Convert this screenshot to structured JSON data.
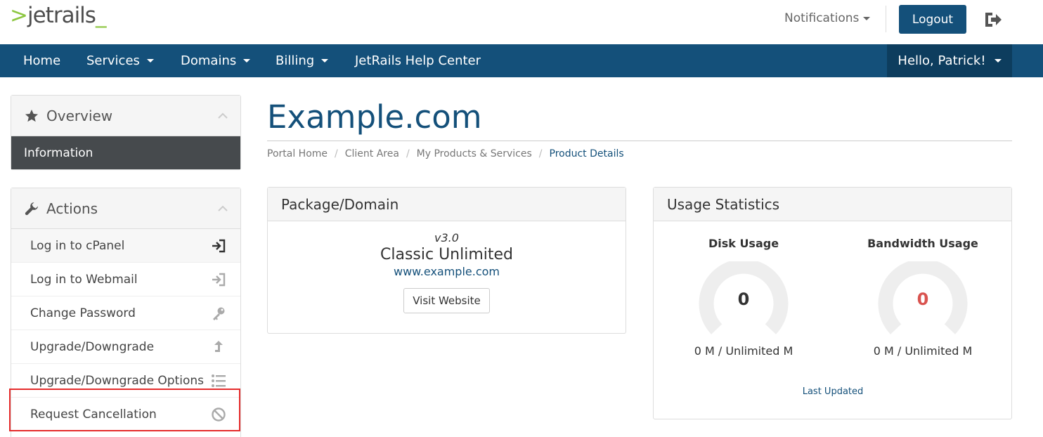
{
  "logo": {
    "prefix": ">",
    "name": "jetrails",
    "suffix": "_"
  },
  "header": {
    "notifications": "Notifications",
    "logout": "Logout"
  },
  "nav": {
    "items": [
      "Home",
      "Services",
      "Domains",
      "Billing",
      "JetRails Help Center"
    ],
    "user": "Hello, Patrick!"
  },
  "sidebar": {
    "overview": {
      "title": "Overview",
      "item": "Information"
    },
    "actions": {
      "title": "Actions",
      "items": [
        "Log in to cPanel",
        "Log in to Webmail",
        "Change Password",
        "Upgrade/Downgrade",
        "Upgrade/Downgrade Options",
        "Request Cancellation"
      ]
    }
  },
  "main": {
    "title": "Example.com",
    "breadcrumb": [
      "Portal Home",
      "Client Area",
      "My Products & Services",
      "Product Details"
    ],
    "package": {
      "heading": "Package/Domain",
      "version": "v3.0",
      "name": "Classic Unlimited",
      "domain": "www.example.com",
      "visit": "Visit Website"
    },
    "usage": {
      "heading": "Usage Statistics",
      "disk": {
        "title": "Disk Usage",
        "value": "0",
        "detail": "0 M / Unlimited M",
        "color": "#333333"
      },
      "bandwidth": {
        "title": "Bandwidth Usage",
        "value": "0",
        "detail": "0 M / Unlimited M",
        "color": "#d9534f"
      },
      "last_updated": "Last Updated"
    }
  },
  "colors": {
    "brand": "#14507a",
    "accent_green": "#8cc63f",
    "highlight_box": "#e52b2b"
  }
}
